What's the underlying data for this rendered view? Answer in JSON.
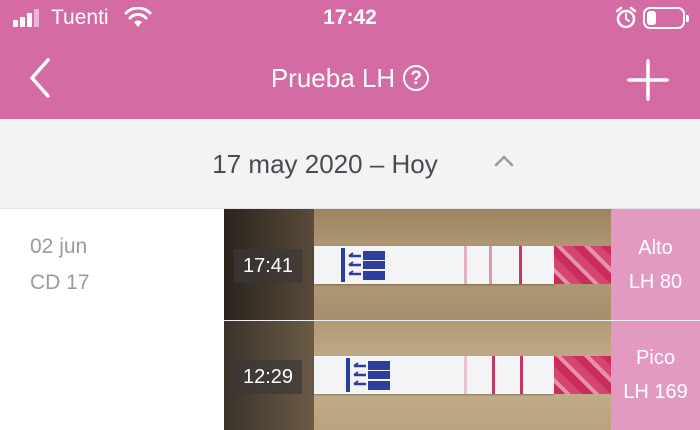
{
  "status_bar": {
    "carrier": "Tuenti",
    "time": "17:42",
    "battery_level": 0.25
  },
  "nav": {
    "title": "Prueba LH",
    "help_symbol": "?",
    "back_icon": "chevron-left-icon",
    "add_icon": "plus-icon"
  },
  "range": {
    "label": "17 may 2020 – Hoy",
    "toggle_icon": "chevron-up-icon"
  },
  "day": {
    "date": "02 jun",
    "cycle_day": "CD 17"
  },
  "tests": [
    {
      "time": "17:41",
      "result": "Alto",
      "lh_value": "LH 80"
    },
    {
      "time": "12:29",
      "result": "Pico",
      "lh_value": "LH 169"
    }
  ],
  "colors": {
    "accent": "#d46ba3",
    "result_badge": "#e39ac2",
    "range_bg": "#f3f3f4",
    "strip_line": "#c4375f"
  }
}
